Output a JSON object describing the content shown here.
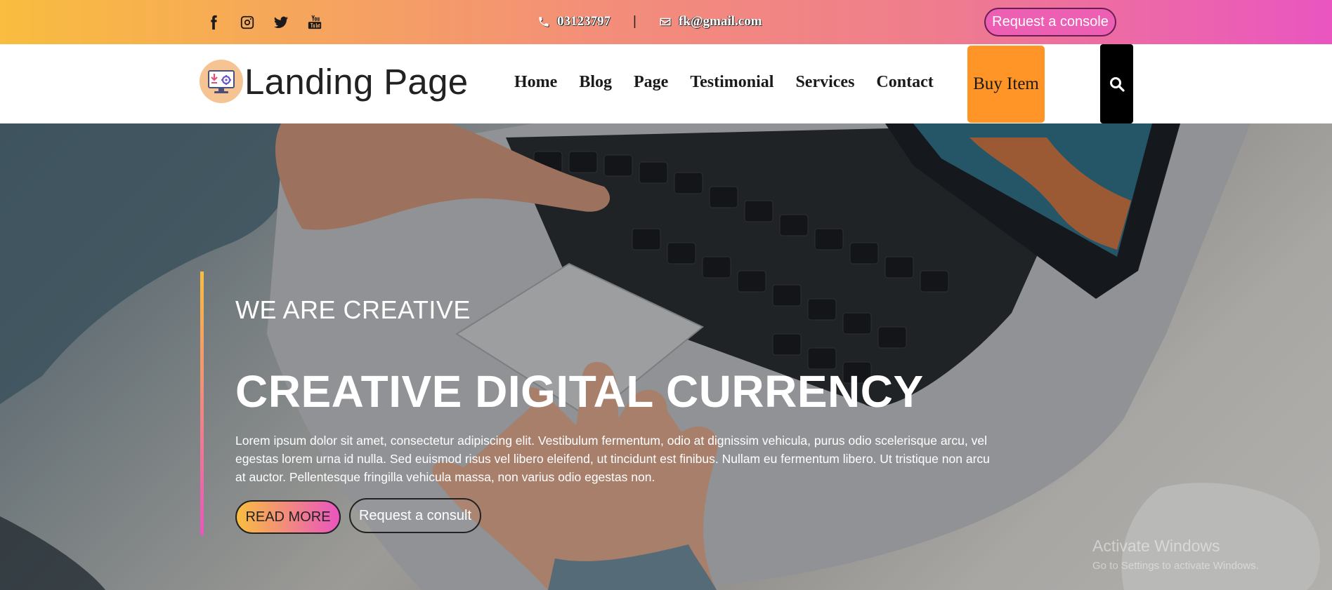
{
  "topbar": {
    "social_icons": [
      "facebook-icon",
      "instagram-icon",
      "twitter-icon",
      "youtube-icon"
    ],
    "phone": "03123797",
    "separator": "|",
    "email": "fk@gmail.com",
    "console_button": "Request a console"
  },
  "navbar": {
    "logo_text": "Landing Page",
    "links": [
      "Home",
      "Blog",
      "Page",
      "Testimonial",
      "Services",
      "Contact"
    ],
    "buy_button": "Buy Item"
  },
  "hero": {
    "tagline": "WE ARE CREATIVE",
    "headline": "CREATIVE DIGITAL CURRENCY",
    "description": "Lorem ipsum dolor sit amet, consectetur adipiscing elit. Vestibulum fermentum, odio at dignissim vehicula, purus odio scelerisque arcu, vel egestas lorem urna id nulla. Sed euismod risus vel libero eleifend, ut tincidunt est finibus. Nullam eu fermentum libero. Ut tristique non arcu at auctor. Pellentesque fringilla vehicula massa, non varius odio egestas non.",
    "read_more": "READ MORE",
    "consult_button": "Request a consult"
  },
  "watermark": {
    "line1": "Activate Windows",
    "line2": "Go to Settings to activate Windows."
  },
  "colors": {
    "gradient_start": "#f9bd3f",
    "gradient_end": "#ea55c0",
    "buy_button": "#ff9527",
    "search_button": "#000000"
  }
}
